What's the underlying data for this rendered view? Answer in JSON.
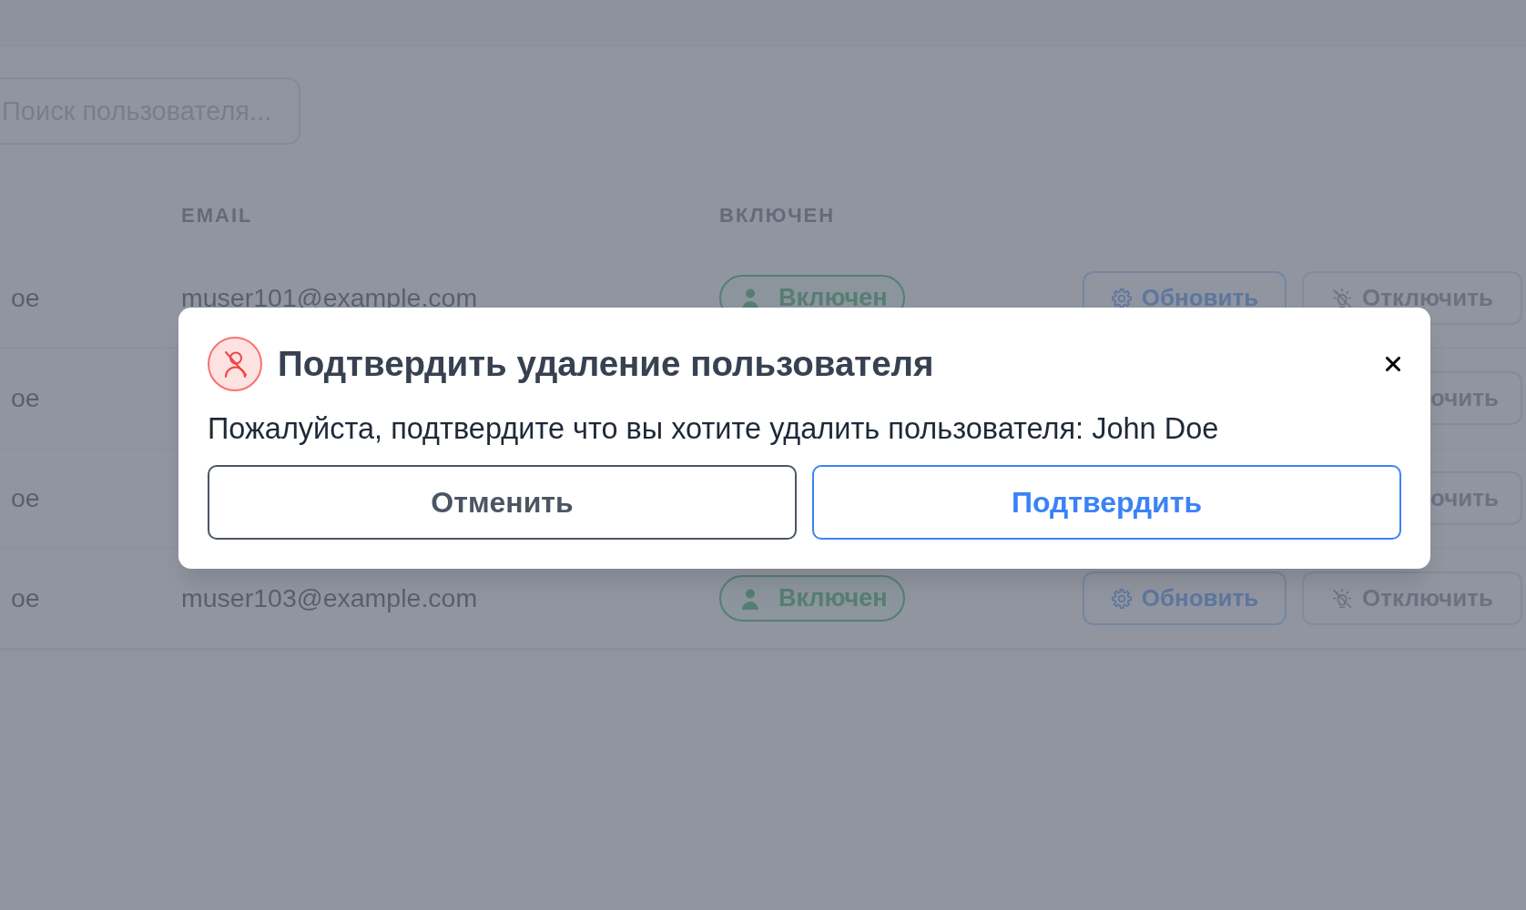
{
  "search": {
    "placeholder": "Поиск пользователя..."
  },
  "table": {
    "columns": [
      "EMAIL",
      "ВКЛЮЧЕН"
    ],
    "rows": [
      {
        "name": "oe",
        "email": "muser101@example.com",
        "status": {
          "label": "Включен",
          "enabled": true
        },
        "actions": [
          {
            "kind": "update",
            "label": "Обновить",
            "covered": false
          },
          {
            "kind": "disable",
            "label": "Отключить",
            "covered": false
          }
        ]
      },
      {
        "name": "oe",
        "actions": [
          {
            "kind": "disable",
            "label": "очить",
            "covered": true
          }
        ]
      },
      {
        "name": "oe",
        "actions": [
          {
            "kind": "disable",
            "label": "очить",
            "covered": true
          }
        ]
      },
      {
        "name": "oe",
        "email": "muser103@example.com",
        "status": {
          "label": "Включен",
          "enabled": true
        },
        "actions": [
          {
            "kind": "update",
            "label": "Обновить",
            "covered": false
          },
          {
            "kind": "disable",
            "label": "Отключить",
            "covered": false
          }
        ]
      }
    ]
  },
  "dialog": {
    "title": "Подтвердить удаление пользователя",
    "message": "Пожалуйста, подтвердите что вы хотите удалить пользователя: John Doe",
    "buttons": [
      {
        "kind": "cancel",
        "label": "Отменить"
      },
      {
        "kind": "confirm",
        "label": "Подтвердить"
      }
    ]
  }
}
